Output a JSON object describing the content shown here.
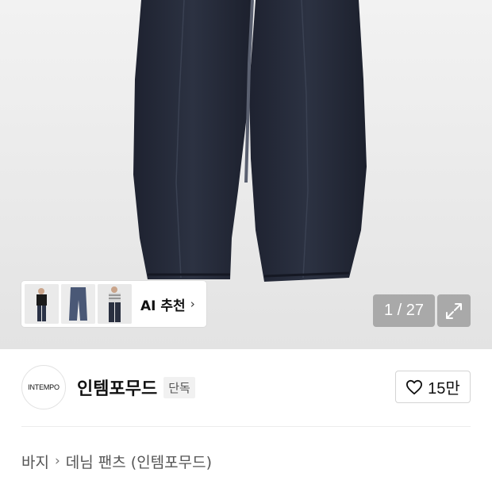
{
  "gallery": {
    "ai_recommend_label": "AI 추천",
    "ai_chevron": "›",
    "page_counter": "1 / 27",
    "thumbnails": [
      "model-black-tee",
      "wide-denim",
      "model-striped"
    ]
  },
  "brand": {
    "logo_text": "INTEMPO",
    "name": "인템포무드",
    "exclusive_badge": "단독",
    "like_count": "15만"
  },
  "breadcrumb": {
    "items": [
      "바지",
      "데님 팬츠 (인템포무드)"
    ],
    "separator": "›"
  },
  "colors": {
    "denim": "#252a38",
    "hero_bg": "#ebebeb",
    "overlay": "#7a7a7a"
  }
}
